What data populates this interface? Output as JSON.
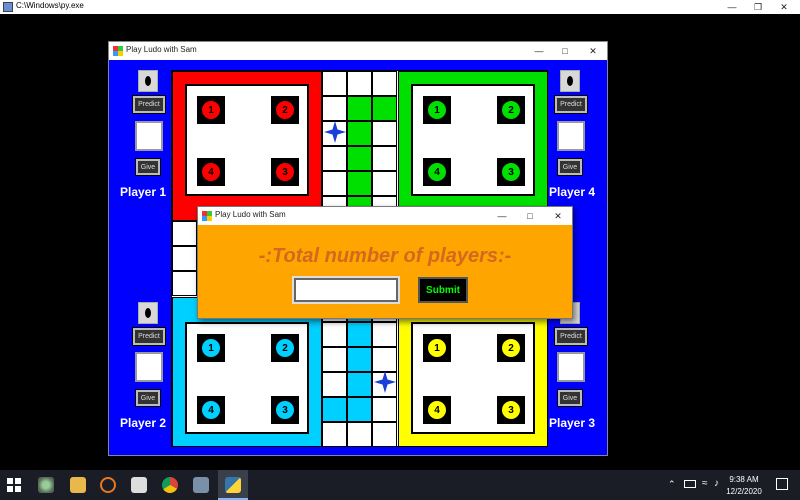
{
  "console": {
    "title": "C:\\Windows\\py.exe"
  },
  "game": {
    "title": "Play Ludo with Sam"
  },
  "controls": {
    "predict_label": "Predict",
    "give_label": "Give"
  },
  "players": {
    "p1": "Player 1",
    "p2": "Player 2",
    "p3": "Player 3",
    "p4": "Player 4"
  },
  "tokens": [
    "1",
    "2",
    "4",
    "3"
  ],
  "colors": {
    "red": "#ff0000",
    "green": "#00e000",
    "cyan": "#00d0ff",
    "yellow": "#ffff00",
    "board_bg": "#0000ff",
    "dialog_bg": "#ffa500",
    "star": "#1a3fd8"
  },
  "dialog": {
    "title": "Play Ludo with Sam",
    "prompt": "-:Total number of players:-",
    "input_value": "",
    "submit_label": "Submit"
  },
  "taskbar": {
    "time": "9:38 AM",
    "date": "12/2/2020"
  },
  "icons": [
    "search-icon",
    "taskview-icon",
    "explorer-icon",
    "chrome-icon",
    "python-icon",
    "notification-icon"
  ]
}
